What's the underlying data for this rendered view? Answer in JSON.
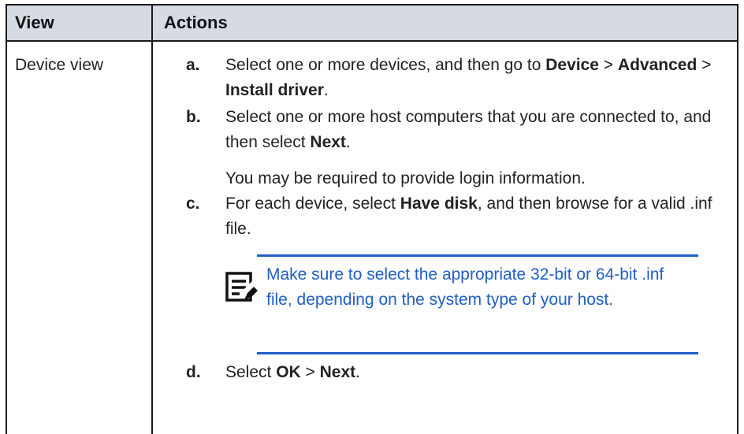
{
  "table": {
    "headers": {
      "view": "View",
      "actions": "Actions"
    },
    "rows": [
      {
        "view": "Device view",
        "steps": {
          "a": {
            "letter": "a.",
            "t1": "Select one or more devices, and then go to ",
            "b1": "Device",
            "t2": " > ",
            "b2": "Advanced",
            "t3": " > ",
            "b3": "Install driver",
            "t4": "."
          },
          "b": {
            "letter": "b.",
            "t1": "Select one or more host computers that you are connected to, and then select ",
            "b1": "Next",
            "t2": ".",
            "sub": "You may be required to provide login information."
          },
          "c": {
            "letter": "c.",
            "t1": "For each device, select ",
            "b1": "Have disk",
            "t2": ", and then browse for a valid .inf file.",
            "note": {
              "icon": "note-pencil-icon",
              "text": "Make sure to select the appropriate 32-bit or 64-bit .inf file, depending on the system type of your host."
            }
          },
          "d": {
            "letter": "d.",
            "t1": "Select ",
            "b1": "OK",
            "t2": " > ",
            "b2": "Next",
            "t3": "."
          }
        }
      }
    ]
  },
  "colors": {
    "header_bg": "#d5dae3",
    "border": "#1a1a1a",
    "note_accent": "#1f5fc6"
  }
}
